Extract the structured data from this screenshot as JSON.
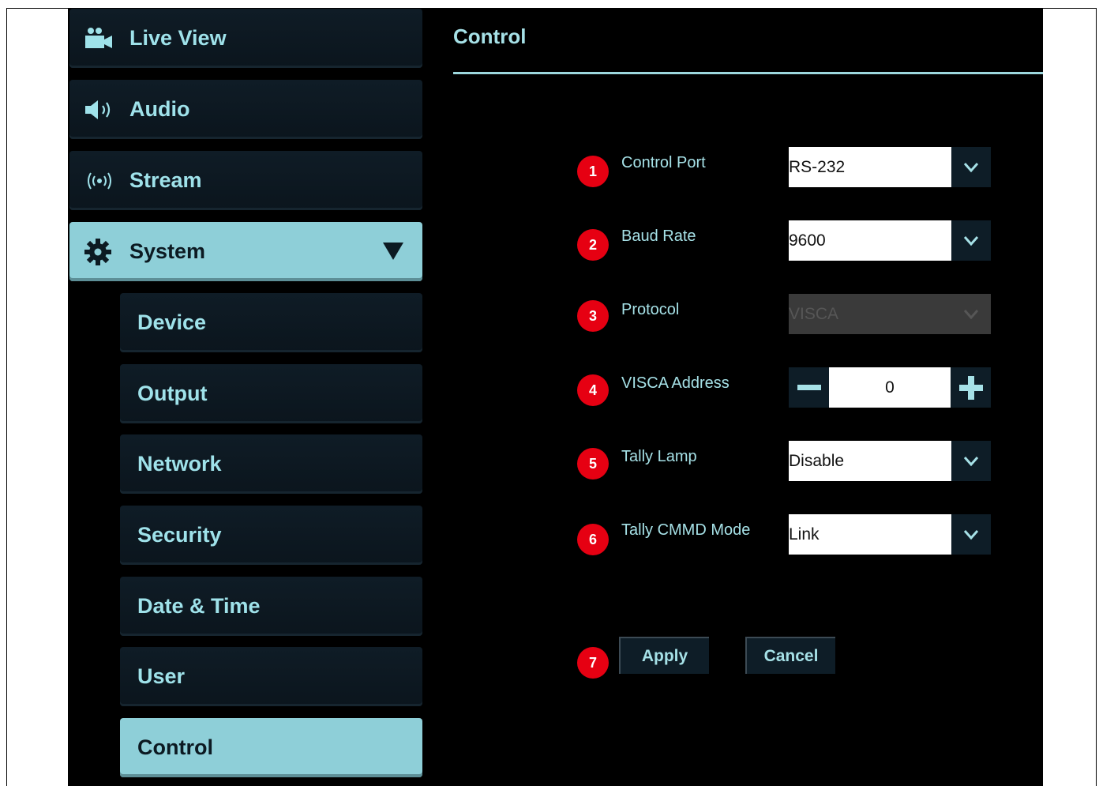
{
  "sidebar": {
    "items": [
      {
        "label": "Live View",
        "icon": "video-camera-icon"
      },
      {
        "label": "Audio",
        "icon": "speaker-icon"
      },
      {
        "label": "Stream",
        "icon": "broadcast-icon"
      },
      {
        "label": "System",
        "icon": "gear-icon",
        "expanded": true
      }
    ],
    "subitems": [
      {
        "label": "Device"
      },
      {
        "label": "Output"
      },
      {
        "label": "Network"
      },
      {
        "label": "Security"
      },
      {
        "label": "Date & Time"
      },
      {
        "label": "User"
      },
      {
        "label": "Control",
        "active": true
      }
    ]
  },
  "page": {
    "title": "Control"
  },
  "form": {
    "control_port": {
      "number": "1",
      "label": "Control Port",
      "value": "RS-232"
    },
    "baud_rate": {
      "number": "2",
      "label": "Baud Rate",
      "value": "9600"
    },
    "protocol": {
      "number": "3",
      "label": "Protocol",
      "value": "VISCA",
      "disabled": true
    },
    "visca_address": {
      "number": "4",
      "label": "VISCA Address",
      "value": "0"
    },
    "tally_lamp": {
      "number": "5",
      "label": "Tally Lamp",
      "value": "Disable"
    },
    "tally_cmmd_mode": {
      "number": "6",
      "label": "Tally CMMD Mode",
      "value": "Link"
    }
  },
  "actions": {
    "number": "7",
    "apply_label": "Apply",
    "cancel_label": "Cancel"
  },
  "colors": {
    "accent": "#8ecfd8",
    "badge": "#e60012",
    "panel": "#0e1d27",
    "text": "#a6e1e7"
  }
}
